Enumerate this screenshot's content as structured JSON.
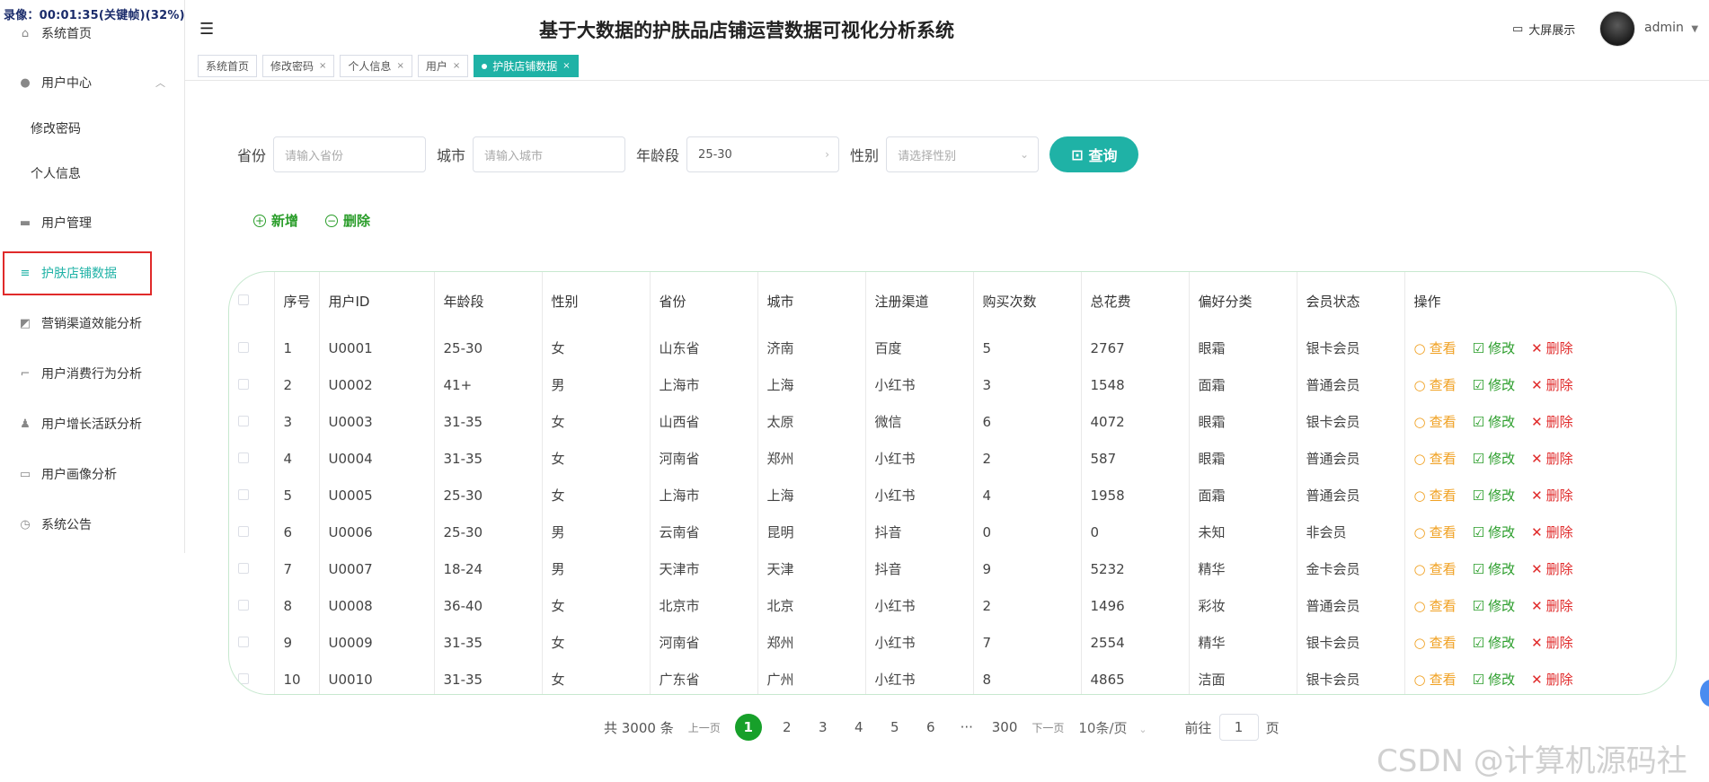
{
  "recording": "录像：00:01:35(关键帧)(32%)",
  "header": {
    "title": "基于大数据的护肤品店铺运营数据可视化分析系统",
    "big_screen": "大屏展示",
    "user": "admin"
  },
  "sidebar": [
    {
      "label": "系统首页",
      "icon": "home-icon"
    },
    {
      "label": "用户中心",
      "icon": "user-icon"
    },
    {
      "label": "修改密码"
    },
    {
      "label": "个人信息"
    },
    {
      "label": "用户管理",
      "icon": "stamp-icon"
    },
    {
      "label": "护肤店铺数据",
      "icon": "list-icon"
    },
    {
      "label": "营销渠道效能分析",
      "icon": "chart-icon"
    },
    {
      "label": "用户消费行为分析",
      "icon": "crop-icon"
    },
    {
      "label": "用户增长活跃分析",
      "icon": "person-icon"
    },
    {
      "label": "用户画像分析",
      "icon": "chat-icon"
    },
    {
      "label": "系统公告",
      "icon": "clock-icon"
    }
  ],
  "tabs": [
    {
      "label": "系统首页"
    },
    {
      "label": "修改密码"
    },
    {
      "label": "个人信息"
    },
    {
      "label": "用户"
    },
    {
      "label": "护肤店铺数据"
    }
  ],
  "search": {
    "province_label": "省份",
    "province_placeholder": "请输入省份",
    "city_label": "城市",
    "city_placeholder": "请输入城市",
    "age_label": "年龄段",
    "age_value": "25-30",
    "gender_label": "性别",
    "gender_placeholder": "请选择性别",
    "query_button": "查询"
  },
  "actions": {
    "add": "新增",
    "delete": "删除"
  },
  "table": {
    "headers": [
      "序号",
      "用户ID",
      "年龄段",
      "性别",
      "省份",
      "城市",
      "注册渠道",
      "购买次数",
      "总花费",
      "偏好分类",
      "会员状态",
      "操作"
    ],
    "op_labels": {
      "view": "查看",
      "edit": "修改",
      "delete": "删除"
    },
    "rows": [
      [
        "1",
        "U0001",
        "25-30",
        "女",
        "山东省",
        "济南",
        "百度",
        "5",
        "2767",
        "眼霜",
        "银卡会员"
      ],
      [
        "2",
        "U0002",
        "41+",
        "男",
        "上海市",
        "上海",
        "小红书",
        "3",
        "1548",
        "面霜",
        "普通会员"
      ],
      [
        "3",
        "U0003",
        "31-35",
        "女",
        "山西省",
        "太原",
        "微信",
        "6",
        "4072",
        "眼霜",
        "银卡会员"
      ],
      [
        "4",
        "U0004",
        "31-35",
        "女",
        "河南省",
        "郑州",
        "小红书",
        "2",
        "587",
        "眼霜",
        "普通会员"
      ],
      [
        "5",
        "U0005",
        "25-30",
        "女",
        "上海市",
        "上海",
        "小红书",
        "4",
        "1958",
        "面霜",
        "普通会员"
      ],
      [
        "6",
        "U0006",
        "25-30",
        "男",
        "云南省",
        "昆明",
        "抖音",
        "0",
        "0",
        "未知",
        "非会员"
      ],
      [
        "7",
        "U0007",
        "18-24",
        "男",
        "天津市",
        "天津",
        "抖音",
        "9",
        "5232",
        "精华",
        "金卡会员"
      ],
      [
        "8",
        "U0008",
        "36-40",
        "女",
        "北京市",
        "北京",
        "小红书",
        "2",
        "1496",
        "彩妆",
        "普通会员"
      ],
      [
        "9",
        "U0009",
        "31-35",
        "女",
        "河南省",
        "郑州",
        "小红书",
        "7",
        "2554",
        "精华",
        "银卡会员"
      ],
      [
        "10",
        "U0010",
        "31-35",
        "女",
        "广东省",
        "广州",
        "小红书",
        "8",
        "4865",
        "洁面",
        "银卡会员"
      ]
    ]
  },
  "pager": {
    "total": "共 3000 条",
    "prev": "上一页",
    "pages": [
      "1",
      "2",
      "3",
      "4",
      "5",
      "6",
      "···",
      "300"
    ],
    "current": "1",
    "next": "下一页",
    "page_size": "10条/页",
    "goto_label": "前往",
    "goto_value": "1",
    "goto_suffix": "页"
  },
  "watermark": "CSDN @计算机源码社",
  "colors": {
    "accent": "#1fb2a6",
    "green": "#17a02a",
    "view": "#f0a020",
    "delete": "#e02a2a"
  }
}
